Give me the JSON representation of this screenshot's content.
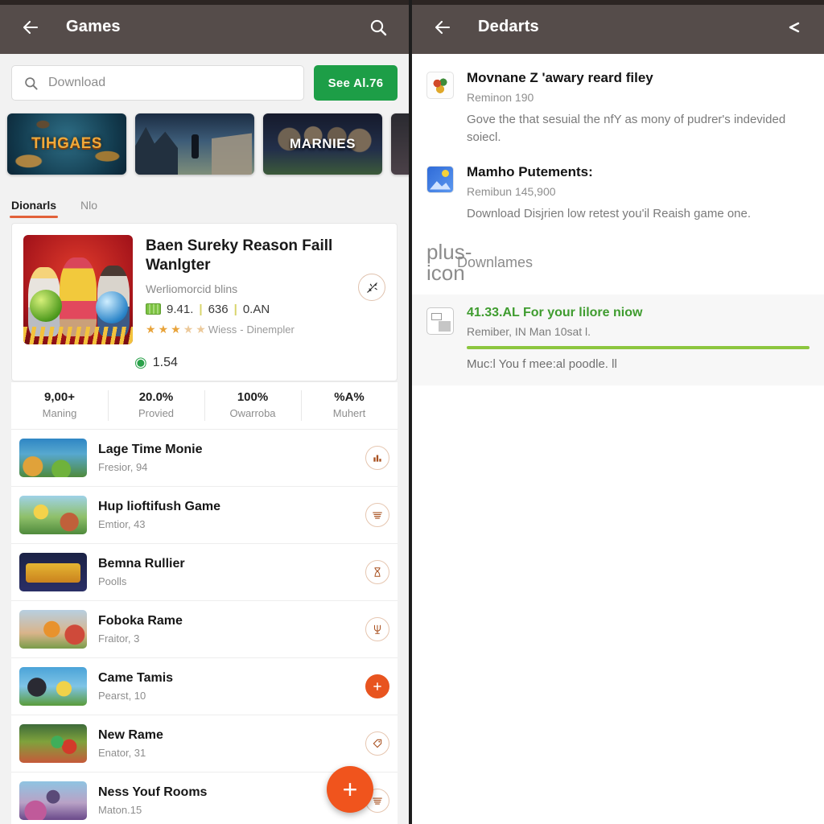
{
  "left": {
    "appbar": {
      "title": "Games",
      "back_icon": "arrow-left-icon",
      "search_icon": "search-icon"
    },
    "search": {
      "placeholder": "Download",
      "icon": "search-icon",
      "button_label": "See Al.76"
    },
    "banners": [
      {
        "label": "TIHGAES"
      },
      {
        "label": ""
      },
      {
        "label": "MARNIES"
      },
      {
        "label": ""
      }
    ],
    "tabs": [
      {
        "label": "Dionarls",
        "active": true
      },
      {
        "label": "Nlo",
        "active": false
      }
    ],
    "featured": {
      "title": "Baen Sureky Reason Faill Wanlgter",
      "subtitle": "Werliomorcid blins",
      "version": "9.41.",
      "count": "636",
      "size": "0.AN",
      "sep": "|",
      "rating_label": "Wiess",
      "rating_dot": "-",
      "category": "Dinempler",
      "location_value": "1.54",
      "action_icon": "sparkle-icon"
    },
    "stats": [
      {
        "value": "9,00+",
        "label": "Maning"
      },
      {
        "value": "20.0%",
        "label": "Provied"
      },
      {
        "value": "100%",
        "label": "Owarroba"
      },
      {
        "value": "%A%",
        "label": "Muhert"
      }
    ],
    "rows": [
      {
        "title": "Lage Time Monie",
        "sub": "Fresior, 94",
        "action": "chart-icon"
      },
      {
        "title": "Hup lioftifush Game",
        "sub": "Emtior, 43",
        "action": "list-icon"
      },
      {
        "title": "Bemna Rullier",
        "sub": "Poolls",
        "action": "hourglass-icon"
      },
      {
        "title": "Foboka Rame",
        "sub": "Fraitor, 3",
        "action": "trident-icon"
      },
      {
        "title": "Came Tamis",
        "sub": "Pearst, 10",
        "action": "plus-circle-icon"
      },
      {
        "title": "New Rame",
        "sub": "Enator, 31",
        "action": "tag-icon"
      },
      {
        "title": "Ness Youf Rooms",
        "sub": "Maton.15",
        "action": "list-icon"
      }
    ],
    "fab": {
      "label": "+",
      "icon": "plus-icon"
    }
  },
  "right": {
    "appbar": {
      "title": "Dedarts",
      "back_icon": "arrow-left-icon",
      "share_icon": "share-icon"
    },
    "items": [
      {
        "title": "Movnane Z 'awary reard filey",
        "meta": "Reminon 190",
        "desc": "Gove the that sesuial the nfY as mony of pudrer's indevided soiecl.",
        "icon": "app-icon-colorful"
      },
      {
        "title": "Mamho Putements:",
        "meta": "Remibun 145,900",
        "desc": "Download Disjrien low retest you'il Reaish game one.",
        "icon": "app-icon-photo"
      }
    ],
    "section": {
      "label": "Downlames",
      "plus_icon": "plus-icon"
    },
    "highlight": {
      "title": "41.33.AL For your lilore niow",
      "sub": "Remiber, IN Man 10sat l.",
      "note": "Muc:l You f mee:al poodle. ll",
      "icon": "window-icon",
      "bar_color": "#8cc63f"
    }
  },
  "colors": {
    "appbar": "#554c4a",
    "green_button": "#1d9e47",
    "accent_orange": "#e2613a",
    "fab": "#f0541d",
    "progress_green": "#8cc63f"
  }
}
